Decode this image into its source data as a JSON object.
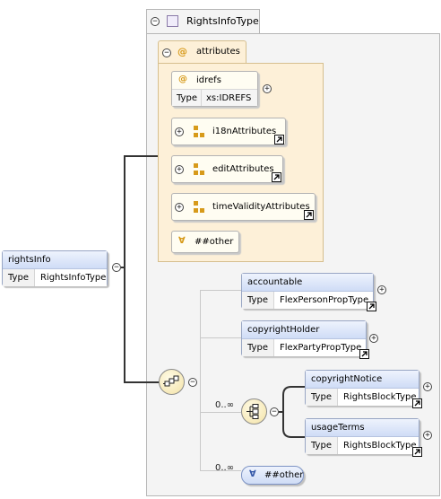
{
  "complex_type": {
    "name": "RightsInfoType"
  },
  "attributes_group": {
    "label": "attributes"
  },
  "idrefs_attr": {
    "name": "idrefs",
    "type_key": "Type",
    "type_value": "xs:IDREFS"
  },
  "attribute_groups": [
    {
      "name": "i18nAttributes"
    },
    {
      "name": "editAttributes"
    },
    {
      "name": "timeValidityAttributes"
    }
  ],
  "any_attribute": {
    "label": "##other"
  },
  "root_element": {
    "name": "rightsInfo",
    "type_key": "Type",
    "type_value": "RightsInfoType"
  },
  "elements": {
    "accountable": {
      "name": "accountable",
      "type_key": "Type",
      "type_value": "FlexPersonPropType"
    },
    "copyrightHolder": {
      "name": "copyrightHolder",
      "type_key": "Type",
      "type_value": "FlexPartyPropType"
    },
    "copyrightNotice": {
      "name": "copyrightNotice",
      "type_key": "Type",
      "type_value": "RightsBlockType"
    },
    "usageTerms": {
      "name": "usageTerms",
      "type_key": "Type",
      "type_value": "RightsBlockType"
    }
  },
  "choice_multiplicity": "0..∞",
  "any_element": {
    "label": "##other",
    "multiplicity": "0..∞"
  },
  "icons": {
    "toggle_minus": "−",
    "toggle_plus": "+",
    "attribute": "@",
    "any": "∀"
  }
}
